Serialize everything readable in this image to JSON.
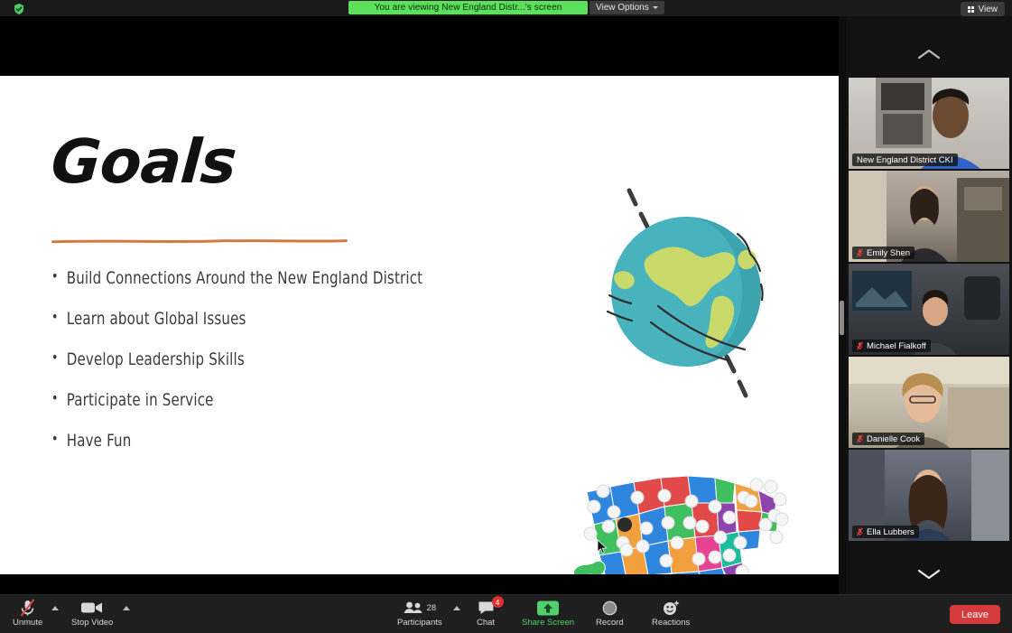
{
  "topbar": {
    "security_icon": "shield-check-icon",
    "share_banner": "You are viewing New England Distr...'s screen",
    "view_options_label": "View Options",
    "view_button_label": "View"
  },
  "slide": {
    "title": "Goals",
    "bullets": [
      "Build Connections Around the New England District",
      "Learn about Global Issues",
      "Develop Leadership Skills",
      "Participate in Service",
      "Have Fun"
    ],
    "rule_color": "#d4793f",
    "globe_colors": {
      "ocean": "#49b3bd",
      "ocean_shade": "#2f97a3",
      "land": "#c9d96a",
      "axis": "#3d3d3d"
    },
    "map_colors": {
      "blue": "#2e86de",
      "red": "#e24a4a",
      "green": "#3fbf5f",
      "orange": "#f2a03d",
      "purple": "#8e44ad",
      "teal": "#1abc9c",
      "pink": "#e84393"
    },
    "toolbar_icons": [
      "arrow-left-icon",
      "pencil-icon",
      "laser-pointer-icon",
      "more-options-icon",
      "arrow-right-icon"
    ]
  },
  "filmstrip": {
    "scroll_up_icon": "chevron-up-icon",
    "scroll_down_icon": "chevron-down-icon",
    "participants": [
      {
        "name": "New England District CKI",
        "muted": false,
        "active_speaker": true
      },
      {
        "name": "Emily Shen",
        "muted": true,
        "active_speaker": false
      },
      {
        "name": "Michael Fialkoff",
        "muted": true,
        "active_speaker": false
      },
      {
        "name": "Danielle Cook",
        "muted": true,
        "active_speaker": false
      },
      {
        "name": "Ella Lubbers",
        "muted": true,
        "active_speaker": false
      }
    ],
    "active_border_color": "#8ed23f"
  },
  "bottombar": {
    "mic": {
      "label": "Unmute",
      "icon": "microphone-muted-icon"
    },
    "video": {
      "label": "Stop Video",
      "icon": "camera-icon"
    },
    "participants": {
      "label": "Participants",
      "count": "28",
      "icon": "people-icon"
    },
    "chat": {
      "label": "Chat",
      "badge": "4",
      "icon": "chat-bubble-icon"
    },
    "share": {
      "label": "Share Screen",
      "icon": "share-up-arrow-icon",
      "color": "#4fd06a"
    },
    "record": {
      "label": "Record",
      "icon": "record-circle-icon"
    },
    "reactions": {
      "label": "Reactions",
      "icon": "smiley-plus-icon"
    },
    "leave": {
      "label": "Leave",
      "color": "#d63b3b"
    }
  }
}
